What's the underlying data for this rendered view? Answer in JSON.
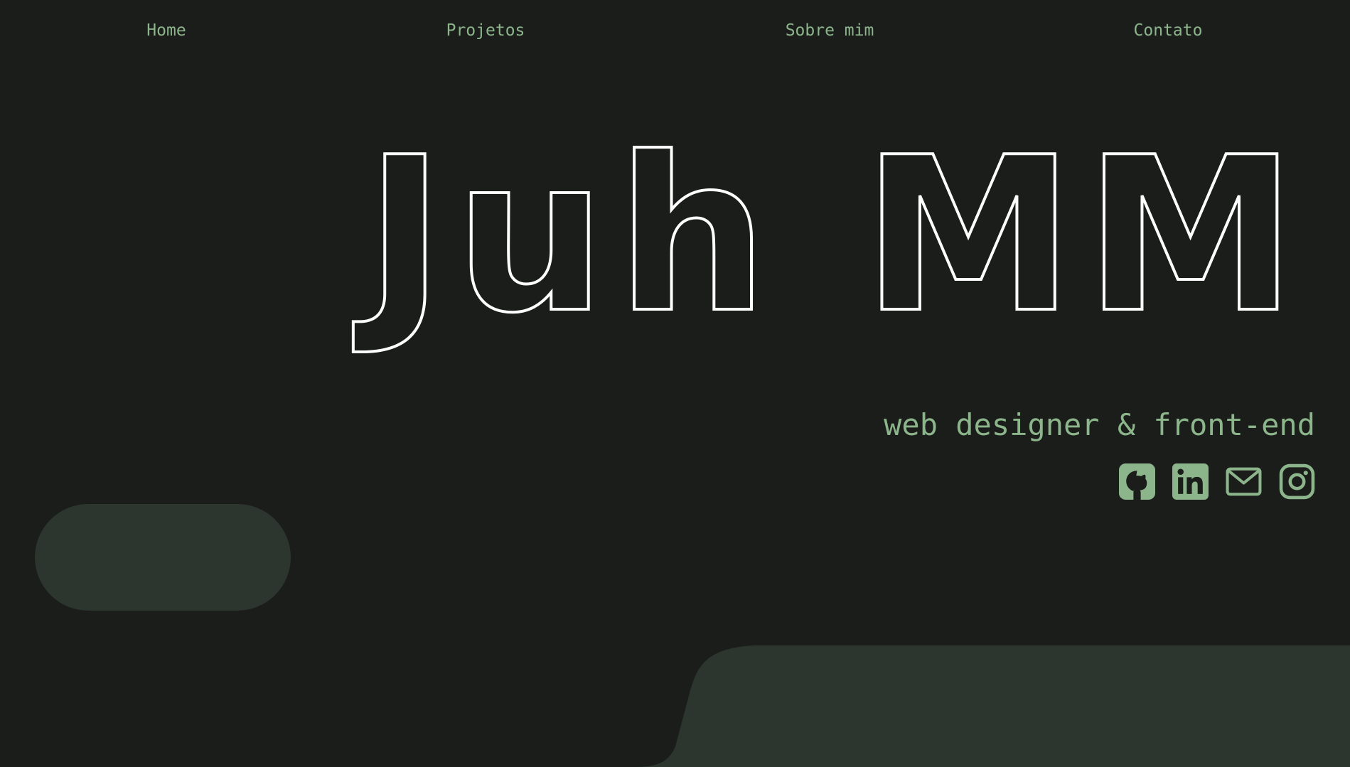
{
  "nav": {
    "items": [
      {
        "label": "Home"
      },
      {
        "label": "Projetos"
      },
      {
        "label": "Sobre mim"
      },
      {
        "label": "Contato"
      }
    ]
  },
  "hero": {
    "title": "Juh MM",
    "subtitle": "web designer & front-end"
  },
  "socials": [
    {
      "icon": "github-icon"
    },
    {
      "icon": "linkedin-icon"
    },
    {
      "icon": "mail-icon"
    },
    {
      "icon": "instagram-icon"
    }
  ],
  "colors": {
    "background": "#1b1d1b",
    "accent": "#8cb58b",
    "shape": "#2c352e",
    "title_stroke": "#ffffff"
  }
}
